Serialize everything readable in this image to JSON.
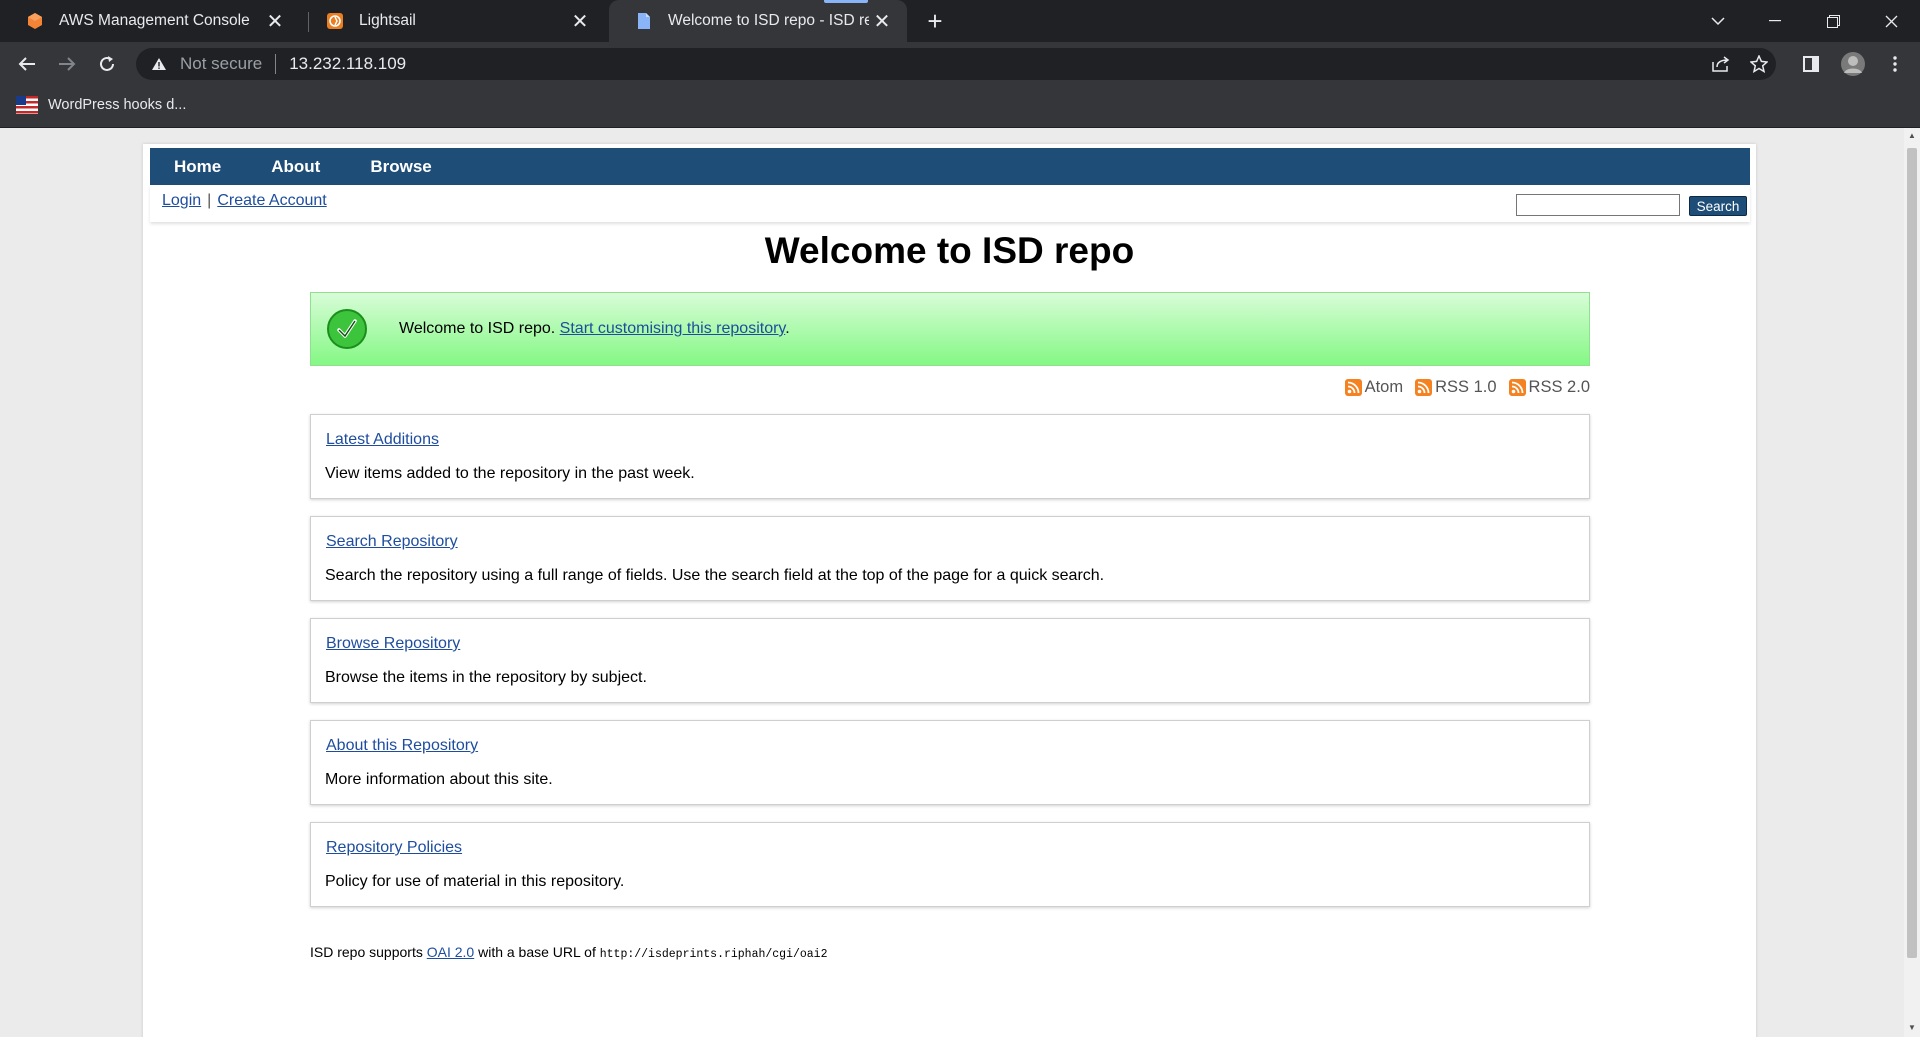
{
  "browser": {
    "tabs": [
      {
        "title": "AWS Management Console",
        "icon": "aws-icon"
      },
      {
        "title": "Lightsail",
        "icon": "lightsail-icon"
      },
      {
        "title": "Welcome to ISD repo - ISD repo",
        "icon": "document-icon",
        "active": true
      }
    ],
    "security_label": "Not secure",
    "url": "13.232.118.109",
    "bookmark": "WordPress hooks d..."
  },
  "site": {
    "menu": [
      "Home",
      "About",
      "Browse"
    ],
    "login": "Login",
    "create_account": "Create Account",
    "search_button": "Search",
    "search_value": ""
  },
  "main": {
    "heading": "Welcome to ISD repo",
    "welcome_text": "Welcome to ISD repo.",
    "welcome_link": "Start customising this repository",
    "welcome_suffix": ".",
    "feeds": [
      "Atom",
      "RSS 1.0",
      "RSS 2.0"
    ],
    "boxes": [
      {
        "title": "Latest Additions",
        "desc": "View items added to the repository in the past week."
      },
      {
        "title": "Search Repository",
        "desc": "Search the repository using a full range of fields. Use the search field at the top of the page for a quick search."
      },
      {
        "title": "Browse Repository",
        "desc": "Browse the items in the repository by subject."
      },
      {
        "title": "About this Repository",
        "desc": "More information about this site."
      },
      {
        "title": "Repository Policies",
        "desc": "Policy for use of material in this repository."
      }
    ]
  },
  "footer": {
    "prefix": "ISD repo supports",
    "oai_link": "OAI 2.0",
    "middle": "with a base URL of",
    "base_url": "http://isdeprints.riphah/cgi/oai2"
  },
  "colors": {
    "menu_bg": "#1e4d78",
    "link": "#1e4d9e",
    "success_green": "#84f884"
  }
}
